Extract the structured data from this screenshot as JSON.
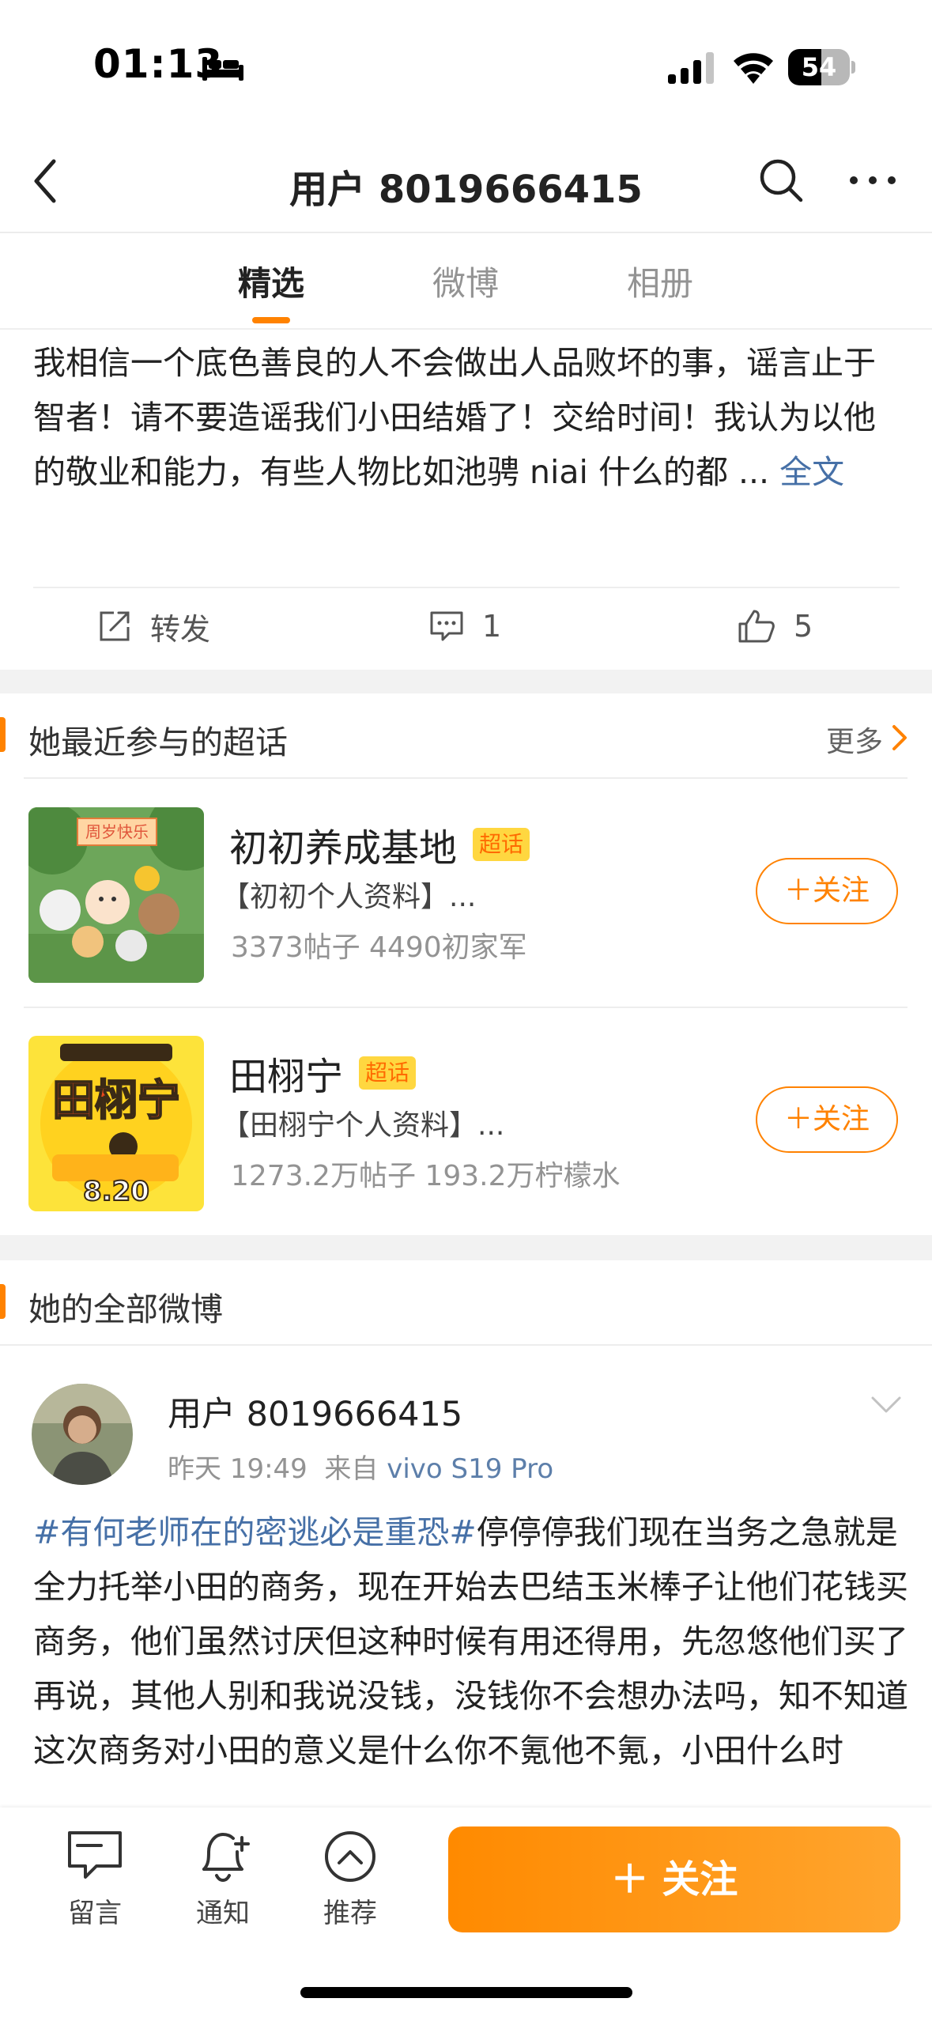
{
  "status_bar": {
    "time": "01:13",
    "battery": "54",
    "battery_level": 0.54
  },
  "nav": {
    "title": "用户 8019666415"
  },
  "tabs": [
    {
      "label": "精选"
    },
    {
      "label": "微博"
    },
    {
      "label": "相册"
    }
  ],
  "pinned_post": {
    "text": "我相信一个底色善良的人不会做出人品败坏的事，谣言止于智者！请不要造谣我们小田结婚了！交给时间！我认为以他的敬业和能力，有些人物比如池骋 niai 什么的都 ... ",
    "more_label": "全文",
    "repost_label": "转发",
    "comment_count": "1",
    "like_count": "5"
  },
  "super_topics": {
    "title": "她最近参与的超话",
    "more_label": "更多",
    "badge_label": "超话",
    "follow_label": "＋关注",
    "items": [
      {
        "name": "初初养成基地",
        "desc": "【初初个人资料】...",
        "stats": "3373帖子 4490初家军",
        "thumb_text": "周岁快乐"
      },
      {
        "name": "田栩宁",
        "desc": "【田栩宁个人资料】...",
        "stats": "1273.2万帖子 193.2万柠檬水",
        "thumb_title": "田栩宁",
        "thumb_date": "8.20"
      }
    ]
  },
  "all_posts": {
    "title": "她的全部微博",
    "post": {
      "user": "用户 8019666415",
      "time": "昨天 19:49",
      "source_prefix": "来自",
      "source": "vivo S19 Pro",
      "hashtag": "#有何老师在的密逃必是重恐#",
      "text": "停停停我们现在当务之急就是全力托举小田的商务，现在开始去巴结玉米棒子让他们花钱买商务，他们虽然讨厌但这种时候有用还得用，先忽悠他们买了再说，其他人别和我说没钱，没钱你不会想办法吗，知不知道这次商务对小田的意义是什么你不氪他不氪，小田什么时"
    }
  },
  "bottom_bar": {
    "message_label": "留言",
    "notify_label": "通知",
    "recommend_label": "推荐",
    "follow_label": "＋ 关注"
  },
  "colors": {
    "accent": "#ff8200",
    "link": "#4670a7"
  }
}
